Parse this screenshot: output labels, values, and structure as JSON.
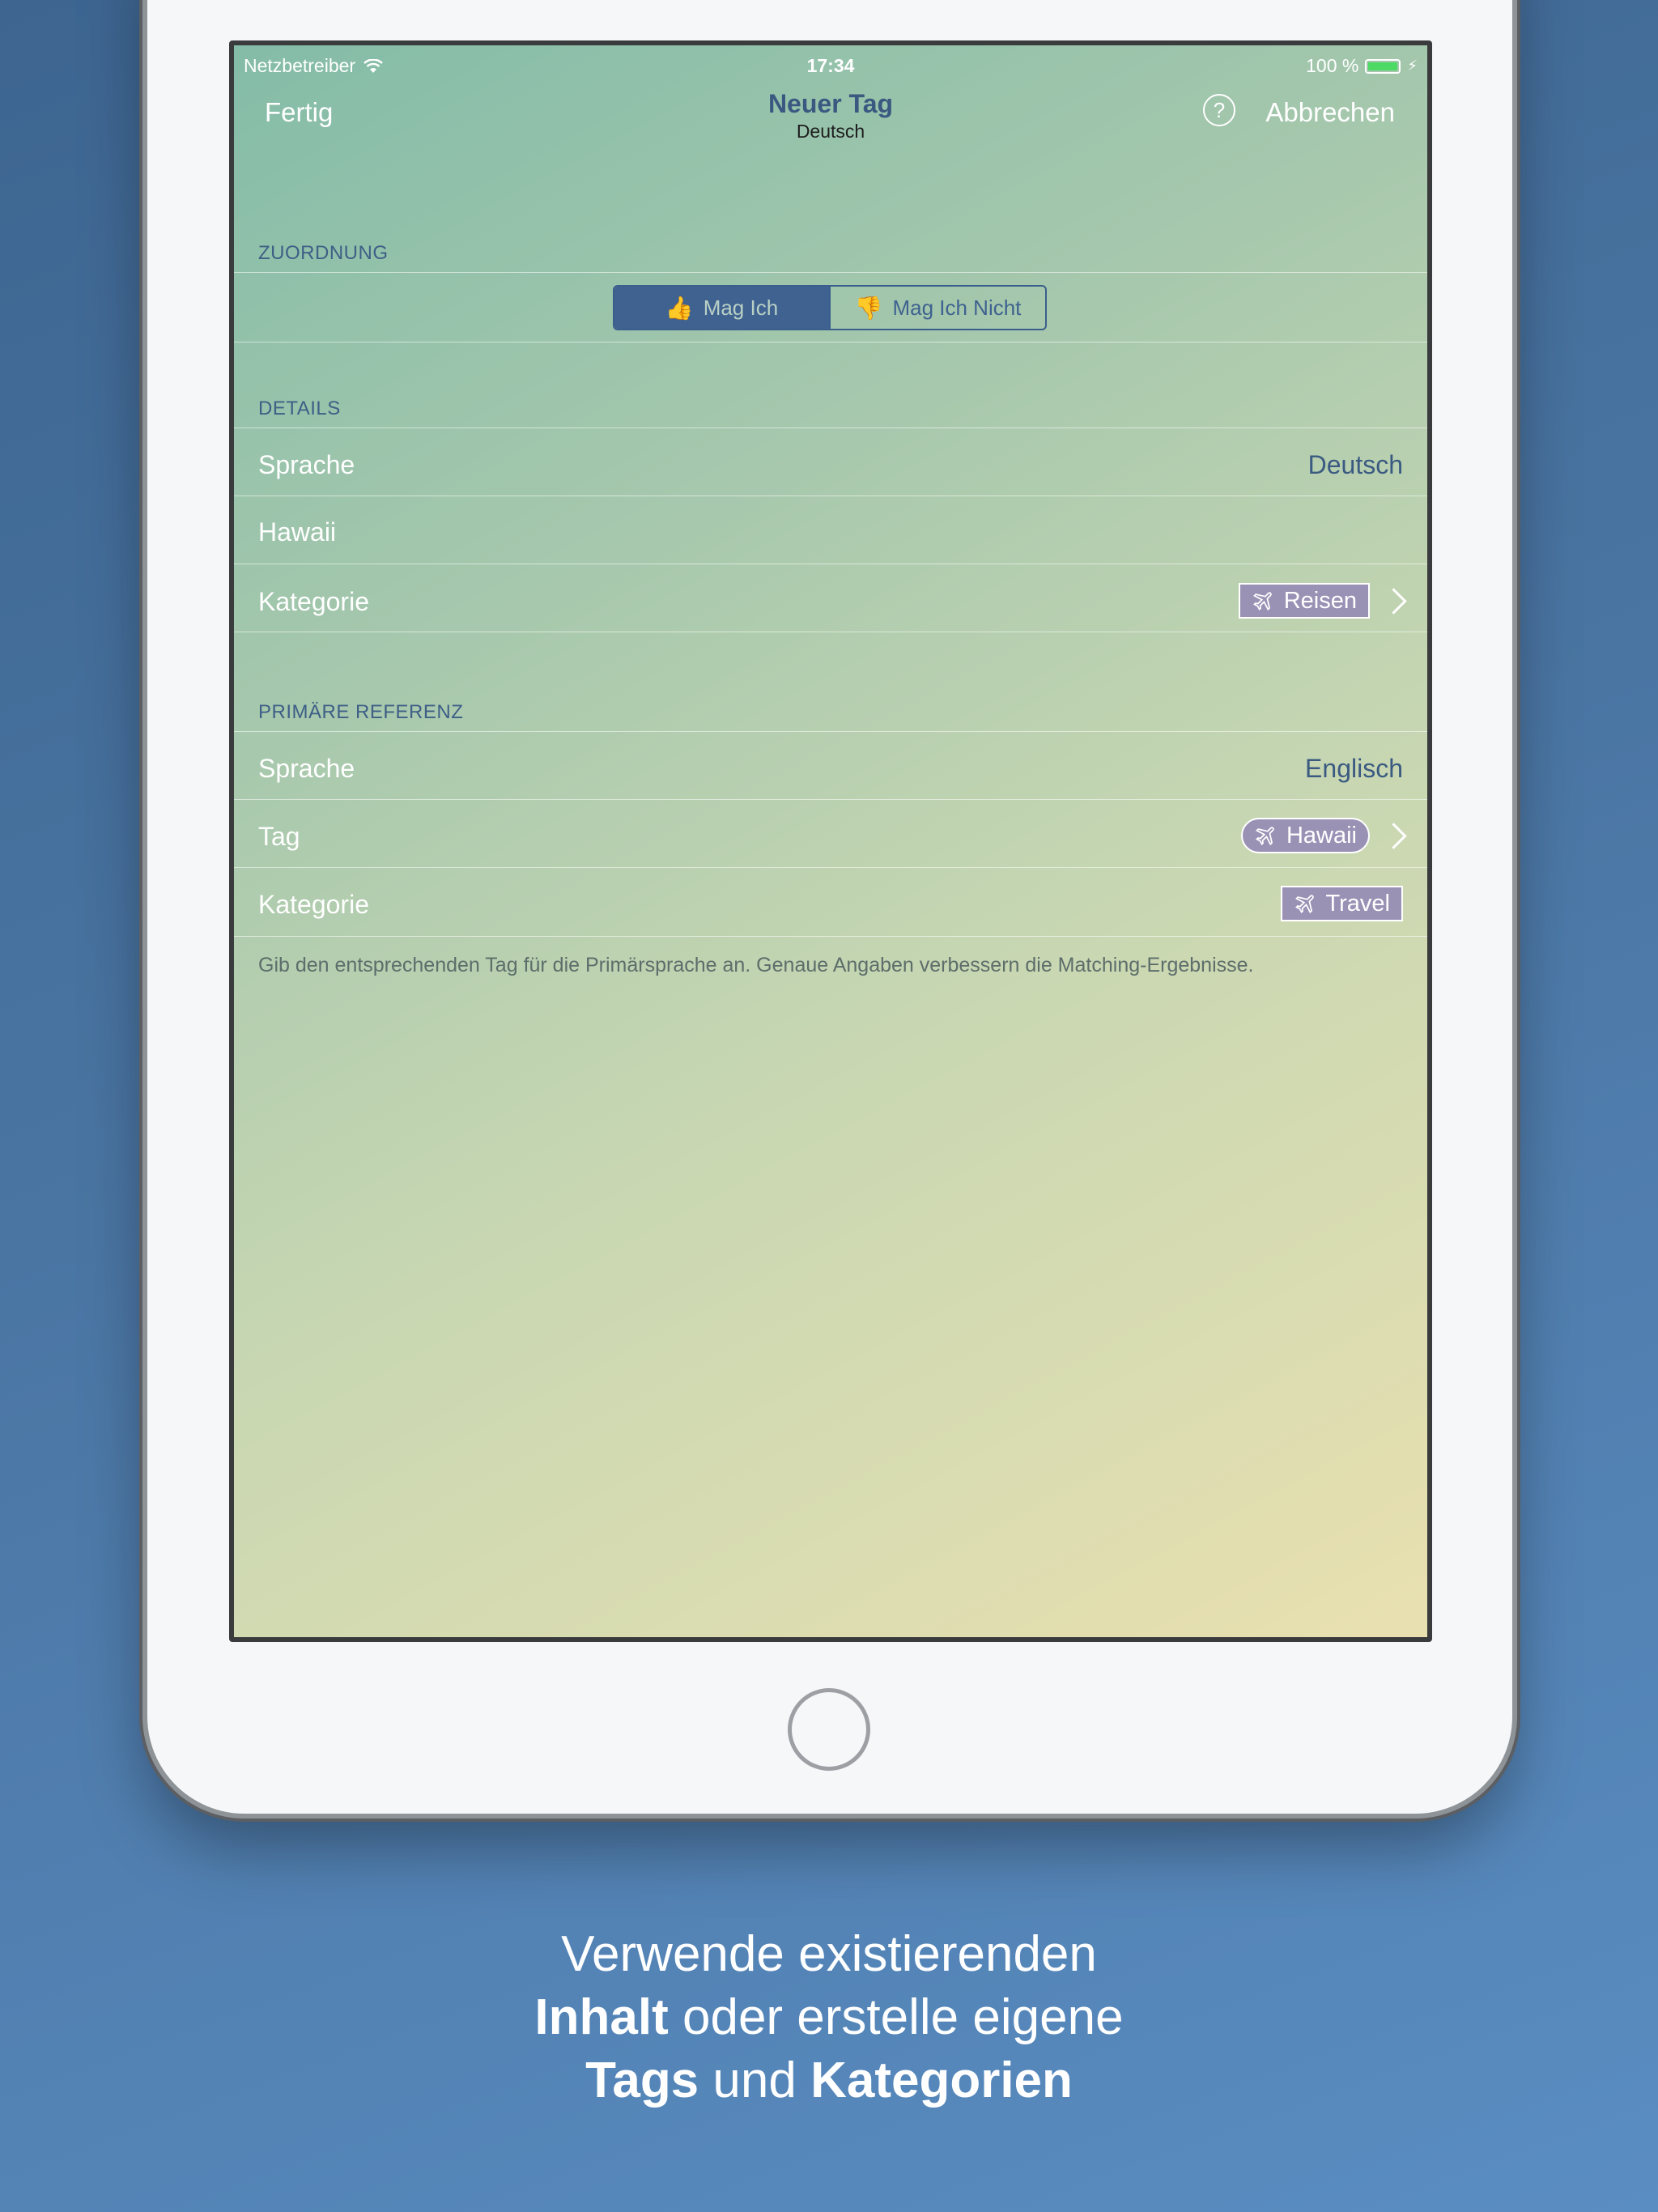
{
  "status": {
    "carrier": "Netzbetreiber",
    "time": "17:34",
    "battery": "100 %"
  },
  "nav": {
    "left": "Fertig",
    "title": "Neuer Tag",
    "subtitle": "Deutsch",
    "help": "?",
    "right": "Abbrechen"
  },
  "zuordnung": {
    "header": "ZUORDNUNG",
    "like": "Mag Ich",
    "dislike": "Mag Ich Nicht"
  },
  "details": {
    "header": "DETAILS",
    "sprache_label": "Sprache",
    "sprache_value": "Deutsch",
    "name": "Hawaii",
    "kategorie_label": "Kategorie",
    "kategorie_value": "Reisen"
  },
  "primaer": {
    "header": "PRIMÄRE REFERENZ",
    "sprache_label": "Sprache",
    "sprache_value": "Englisch",
    "tag_label": "Tag",
    "tag_value": "Hawaii",
    "kategorie_label": "Kategorie",
    "kategorie_value": "Travel",
    "note": "Gib den entsprechenden Tag für die Primärsprache an. Genaue Angaben verbessern die Matching-Ergebnisse."
  },
  "caption": {
    "line1": "Verwende existierenden",
    "line2_bold": "Inhalt",
    "line2_rest": " oder erstelle eigene",
    "line3_bold1": "Tags",
    "line3_mid": " und ",
    "line3_bold2": "Kategorien"
  }
}
